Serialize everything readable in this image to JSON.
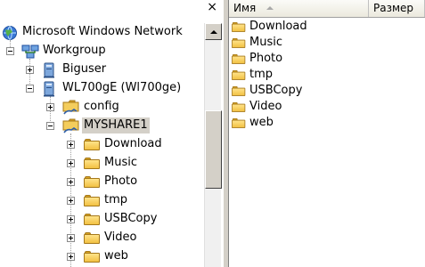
{
  "tree": {
    "close_glyph": "×",
    "nodes": [
      {
        "label": "Microsoft Windows Network",
        "icon": "network-icon",
        "expander": "none",
        "selected": false
      },
      {
        "label": "Workgroup",
        "icon": "workgroup-icon",
        "expander": "minus",
        "selected": false
      },
      {
        "label": "Biguser",
        "icon": "computer-icon",
        "expander": "plus",
        "selected": false
      },
      {
        "label": "WL700gE (Wl700ge)",
        "icon": "computer-icon",
        "expander": "minus",
        "selected": false
      },
      {
        "label": "config",
        "icon": "shared-folder-icon",
        "expander": "plus",
        "selected": false
      },
      {
        "label": "MYSHARE1",
        "icon": "shared-folder-icon",
        "expander": "minus",
        "selected": true
      },
      {
        "label": "Download",
        "icon": "folder-icon",
        "expander": "plus",
        "selected": false
      },
      {
        "label": "Music",
        "icon": "folder-icon",
        "expander": "plus",
        "selected": false
      },
      {
        "label": "Photo",
        "icon": "folder-icon",
        "expander": "plus",
        "selected": false
      },
      {
        "label": "tmp",
        "icon": "folder-icon",
        "expander": "plus",
        "selected": false
      },
      {
        "label": "USBCopy",
        "icon": "folder-icon",
        "expander": "plus",
        "selected": false
      },
      {
        "label": "Video",
        "icon": "folder-icon",
        "expander": "plus",
        "selected": false
      },
      {
        "label": "web",
        "icon": "folder-icon",
        "expander": "plus",
        "selected": false
      }
    ]
  },
  "list": {
    "columns": {
      "name": "Имя",
      "size": "Размер"
    },
    "sort_icon": "sort-ascending-icon",
    "items": [
      "Download",
      "Music",
      "Photo",
      "tmp",
      "USBCopy",
      "Video",
      "web"
    ]
  },
  "colors": {
    "folder": "#f2c143",
    "selection": "#d4d0c8",
    "chrome": "#d4d0c8"
  }
}
